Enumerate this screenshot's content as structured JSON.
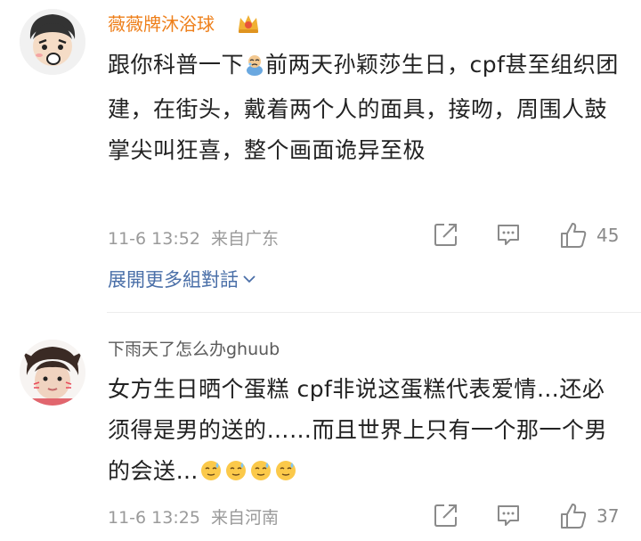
{
  "comments": [
    {
      "username": "薇薇牌沐浴球",
      "text_before_emoji": "跟你科普一下",
      "text_after_emoji": "前两天孙颖莎生日，cpf甚至组织团建，在街头，戴着两个人的面具，接吻，周围人鼓掌尖叫狂喜，整个画面诡异至极",
      "timestamp": "11-6 13:52",
      "location": "来自广东",
      "likes": "45",
      "expand_label": "展開更多組對話",
      "name_color": "#ee7f1a",
      "badge_icon": "vip-crown-badge"
    },
    {
      "username": "下雨天了怎么办ghuub",
      "text": "女方生日晒个蛋糕 cpf非说这蛋糕代表爱情…还必须得是男的送的……而且世界上只有一个那一个男的会送…",
      "timestamp": "11-6 13:25",
      "location": "来自河南",
      "likes": "37",
      "emoji_count": 4
    }
  ],
  "actions": {
    "share_icon": "share-icon",
    "comment_icon": "comment-icon",
    "like_icon": "thumbs-up-icon"
  },
  "colors": {
    "link": "#4a6fa8",
    "meta_text": "#9a9a9a",
    "body_text": "#222222"
  }
}
